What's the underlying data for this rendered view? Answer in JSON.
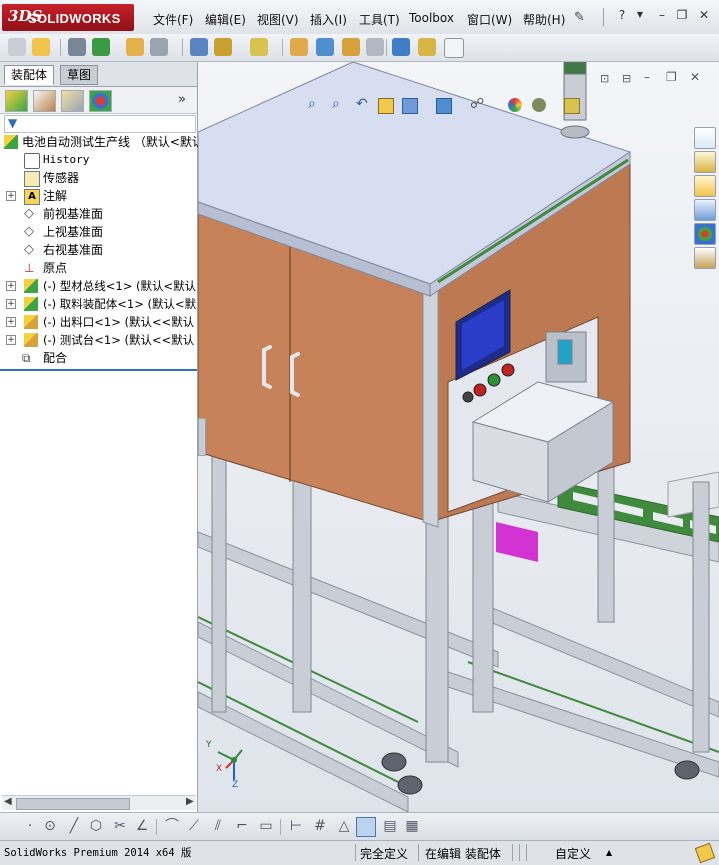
{
  "app": {
    "brand_prefix": "3DS",
    "brand_name": "SOLIDWORKS",
    "status_version": "SolidWorks Premium 2014 x64 版"
  },
  "menu": {
    "items": [
      "文件(F)",
      "编辑(E)",
      "视图(V)",
      "插入(I)",
      "工具(T)",
      "Toolbox",
      "窗口(W)",
      "帮助(H)"
    ]
  },
  "panel": {
    "tabs": [
      "装配体",
      "草图"
    ],
    "tree": [
      {
        "label": "电池自动测试生产线  （默认<默认",
        "icon": "assembly-icon",
        "kind": "root"
      },
      {
        "label": "History",
        "icon": "history-icon",
        "kind": "item"
      },
      {
        "label": "传感器",
        "icon": "sensor-icon",
        "kind": "item"
      },
      {
        "label": "注解",
        "icon": "annotation-icon",
        "kind": "expand"
      },
      {
        "label": "前视基准面",
        "icon": "plane-icon",
        "kind": "item"
      },
      {
        "label": "上视基准面",
        "icon": "plane-icon",
        "kind": "item"
      },
      {
        "label": "右视基准面",
        "icon": "plane-icon",
        "kind": "item"
      },
      {
        "label": "原点",
        "icon": "origin-icon",
        "kind": "item"
      },
      {
        "label": "(-) 型材总线<1> (默认<默认",
        "icon": "subassembly-icon",
        "kind": "expand"
      },
      {
        "label": "(-) 取料装配体<1> (默认<默",
        "icon": "subassembly-icon",
        "kind": "expand"
      },
      {
        "label": "(-) 出料口<1> (默认<<默认",
        "icon": "subassembly-icon",
        "kind": "expand"
      },
      {
        "label": "(-) 测试台<1> (默认<<默认",
        "icon": "subassembly-icon",
        "kind": "expand"
      },
      {
        "label": "配合",
        "icon": "mates-icon",
        "kind": "item"
      }
    ]
  },
  "triad": {
    "y": "Y",
    "x": "X",
    "z": "Z"
  },
  "status": {
    "state": "完全定义",
    "mode": "在编辑 装配体",
    "units": "自定义"
  },
  "colors": {
    "brand_red": "#b8161e",
    "panel_orange": "#c8825a",
    "frame_silver": "#c9ced6",
    "top_lavender": "#d8def2",
    "screen_blue": "#2a3dc8",
    "belt_green": "#3f8a3c",
    "accent_magenta": "#d233d2"
  }
}
